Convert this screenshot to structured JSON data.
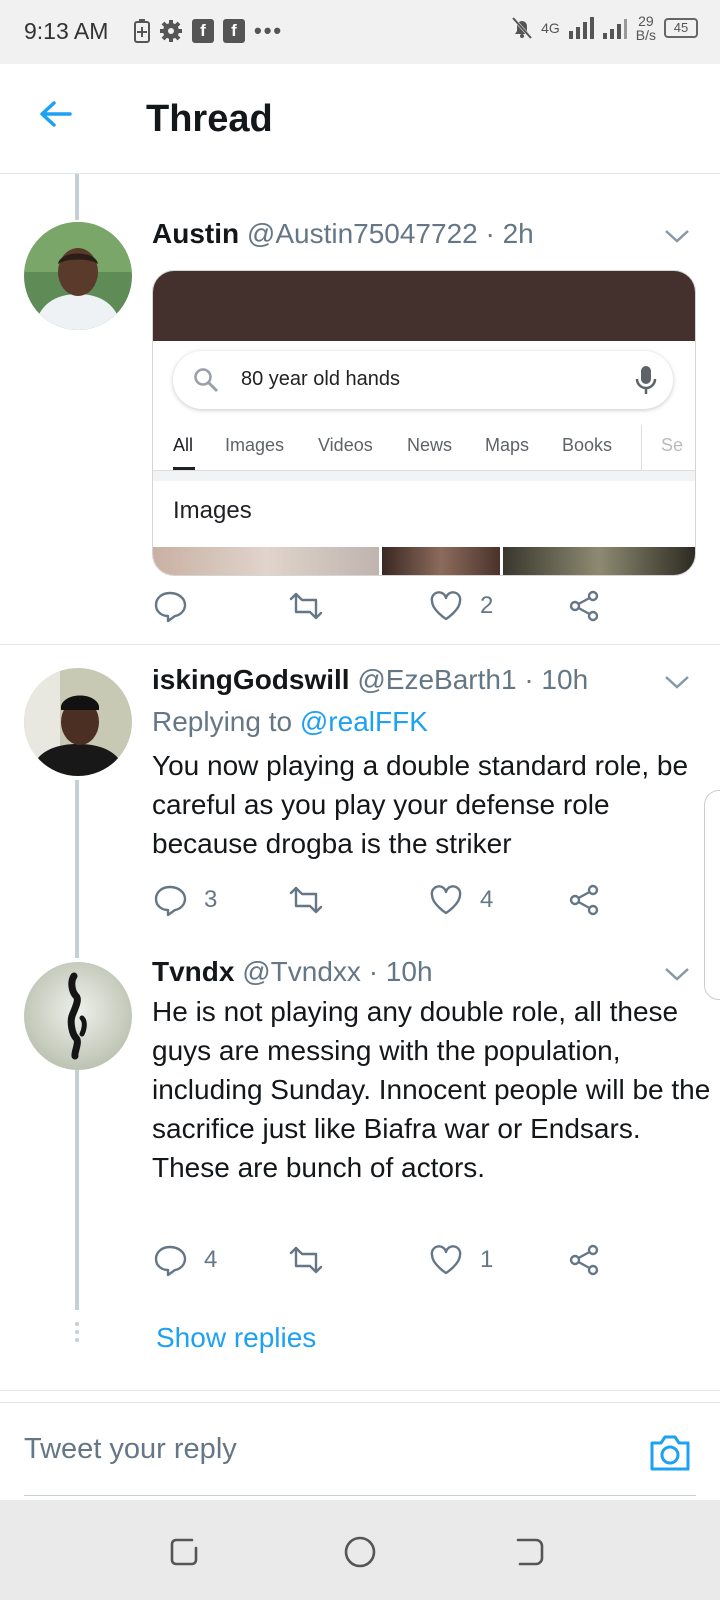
{
  "status_bar": {
    "time": "9:13 AM",
    "network_speed_value": "29",
    "network_speed_unit": "B/s",
    "network_type": "4G",
    "battery": "45"
  },
  "header": {
    "title": "Thread"
  },
  "tweets": [
    {
      "name": "Austin",
      "handle": "@Austin75047722 · 2h",
      "embed": {
        "query": "80 year old hands",
        "tabs": [
          "All",
          "Images",
          "Videos",
          "News",
          "Maps",
          "Books",
          "Se"
        ],
        "section": "Images"
      },
      "replies": "",
      "retweets": "",
      "likes": "2"
    },
    {
      "name": "iskingGodswill",
      "handle": "@EzeBarth1 · 10h",
      "replying_label": "Replying to ",
      "replying_handle": "@realFFK",
      "text": "You now playing a double standard role, be careful as you play your defense role because drogba is the striker",
      "replies": "3",
      "retweets": "",
      "likes": "4"
    },
    {
      "name": "Tvndx",
      "handle": "@Tvndxx · 10h",
      "text": "He is not playing any double role, all these guys are messing with the population, including Sunday. Innocent people will be the sacrifice just like Biafra war or Endsars. These are bunch of actors.",
      "replies": "4",
      "retweets": "",
      "likes": "1"
    }
  ],
  "show_replies": "Show replies",
  "reply_box": {
    "placeholder": "Tweet your reply"
  },
  "colors": {
    "accent": "#1da1f2",
    "secondary_text": "#657786",
    "divider": "#e1e8ed"
  }
}
